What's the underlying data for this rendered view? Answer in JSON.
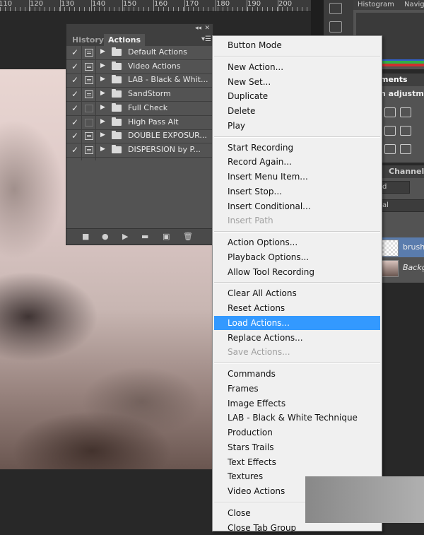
{
  "ruler": {
    "labels": [
      "110",
      "120",
      "130",
      "140",
      "150",
      "160",
      "170",
      "180",
      "190",
      "200"
    ]
  },
  "right_panel": {
    "histogram_tab": "Histogram",
    "navigator_tab": "Navig",
    "adjustments_tab": "ments",
    "adjustments_title": "n adjustme",
    "channels_tab": "Channels",
    "blend_mode": "d",
    "opacity_field": "al",
    "layers": [
      {
        "name": "brush"
      },
      {
        "name": "Backg"
      }
    ]
  },
  "actions_panel": {
    "tabs": [
      {
        "label": "History",
        "active": false
      },
      {
        "label": "Actions",
        "active": true
      }
    ],
    "rows": [
      {
        "checked": true,
        "dialog": true,
        "label": "Default Actions"
      },
      {
        "checked": true,
        "dialog": true,
        "label": "Video Actions"
      },
      {
        "checked": true,
        "dialog": true,
        "label": "LAB - Black & Whit..."
      },
      {
        "checked": true,
        "dialog": true,
        "label": "SandStorm"
      },
      {
        "checked": true,
        "dialog": false,
        "label": "Full Check"
      },
      {
        "checked": true,
        "dialog": false,
        "label": "High Pass Alt"
      },
      {
        "checked": true,
        "dialog": true,
        "label": "DOUBLE EXPOSUR..."
      },
      {
        "checked": true,
        "dialog": true,
        "label": "DISPERSION by P..."
      }
    ]
  },
  "context_menu": {
    "groups": [
      [
        {
          "label": "Button Mode",
          "disabled": false
        }
      ],
      [
        {
          "label": "New Action...",
          "disabled": false
        },
        {
          "label": "New Set...",
          "disabled": false
        },
        {
          "label": "Duplicate",
          "disabled": false
        },
        {
          "label": "Delete",
          "disabled": false
        },
        {
          "label": "Play",
          "disabled": false
        }
      ],
      [
        {
          "label": "Start Recording",
          "disabled": false
        },
        {
          "label": "Record Again...",
          "disabled": false
        },
        {
          "label": "Insert Menu Item...",
          "disabled": false
        },
        {
          "label": "Insert Stop...",
          "disabled": false
        },
        {
          "label": "Insert Conditional...",
          "disabled": false
        },
        {
          "label": "Insert Path",
          "disabled": true
        }
      ],
      [
        {
          "label": "Action Options...",
          "disabled": false
        },
        {
          "label": "Playback Options...",
          "disabled": false
        },
        {
          "label": "Allow Tool Recording",
          "disabled": false
        }
      ],
      [
        {
          "label": "Clear All Actions",
          "disabled": false
        },
        {
          "label": "Reset Actions",
          "disabled": false
        },
        {
          "label": "Load Actions...",
          "disabled": false,
          "highlighted": true
        },
        {
          "label": "Replace Actions...",
          "disabled": false
        },
        {
          "label": "Save Actions...",
          "disabled": true
        }
      ],
      [
        {
          "label": "Commands",
          "disabled": false
        },
        {
          "label": "Frames",
          "disabled": false
        },
        {
          "label": "Image Effects",
          "disabled": false
        },
        {
          "label": "LAB - Black & White Technique",
          "disabled": false
        },
        {
          "label": "Production",
          "disabled": false
        },
        {
          "label": "Stars Trails",
          "disabled": false
        },
        {
          "label": "Text Effects",
          "disabled": false
        },
        {
          "label": "Textures",
          "disabled": false
        },
        {
          "label": "Video Actions",
          "disabled": false
        }
      ],
      [
        {
          "label": "Close",
          "disabled": false
        },
        {
          "label": "Close Tab Group",
          "disabled": false
        }
      ]
    ]
  },
  "colors": {
    "menu_highlight": "#3399ff",
    "panel_bg": "#535353",
    "app_bg": "#282828"
  }
}
